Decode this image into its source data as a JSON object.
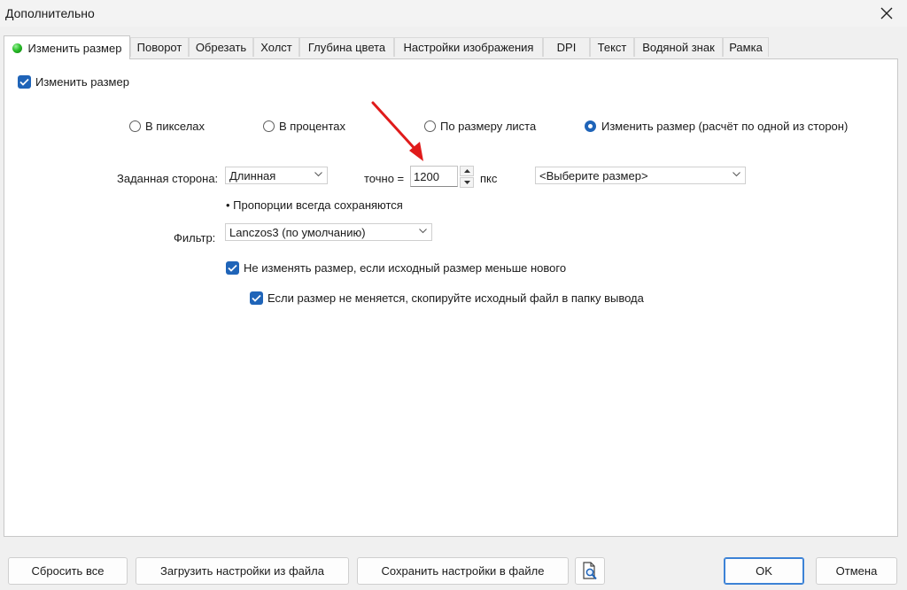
{
  "window": {
    "title": "Дополнительно"
  },
  "tabs": [
    {
      "label": "Изменить размер",
      "active": true
    },
    {
      "label": "Поворот"
    },
    {
      "label": "Обрезать"
    },
    {
      "label": "Холст"
    },
    {
      "label": "Глубина цвета"
    },
    {
      "label": "Настройки изображения"
    },
    {
      "label": "DPI"
    },
    {
      "label": "Текст"
    },
    {
      "label": "Водяной знак"
    },
    {
      "label": "Рамка"
    }
  ],
  "resize": {
    "enable_label": "Изменить размер",
    "enable_checked": true,
    "mode_options": [
      {
        "label": "В пикселах",
        "selected": false
      },
      {
        "label": "В процентах",
        "selected": false
      },
      {
        "label": "По размеру листа",
        "selected": false
      },
      {
        "label": "Изменить размер (расчёт по одной из сторон)",
        "selected": true
      }
    ],
    "side_label": "Заданная сторона:",
    "side_value": "Длинная",
    "exact_label": "точно =",
    "size_value": "1200",
    "unit_label": "пкс",
    "preset_value": "<Выберите размер>",
    "proportions_note": "• Пропорции всегда сохраняются",
    "filter_label": "Фильтр:",
    "filter_value": "Lanczos3 (по умолчанию)",
    "no_upscale_label": "Не изменять размер, если исходный размер меньше нового",
    "no_upscale_checked": true,
    "copy_original_label": "Если размер не меняется, скопируйте исходный файл в папку вывода",
    "copy_original_checked": true
  },
  "annotation": {
    "arrow_color": "#e01b1b"
  },
  "footer": {
    "reset_all": "Сбросить все",
    "load_settings": "Загрузить настройки из файла",
    "save_settings": "Сохранить настройки в файле",
    "preview_icon": "document-magnifier-icon",
    "ok": "OK",
    "cancel": "Отмена"
  },
  "colors": {
    "accent": "#1f64b8",
    "status_dot": "#2cc02c"
  }
}
